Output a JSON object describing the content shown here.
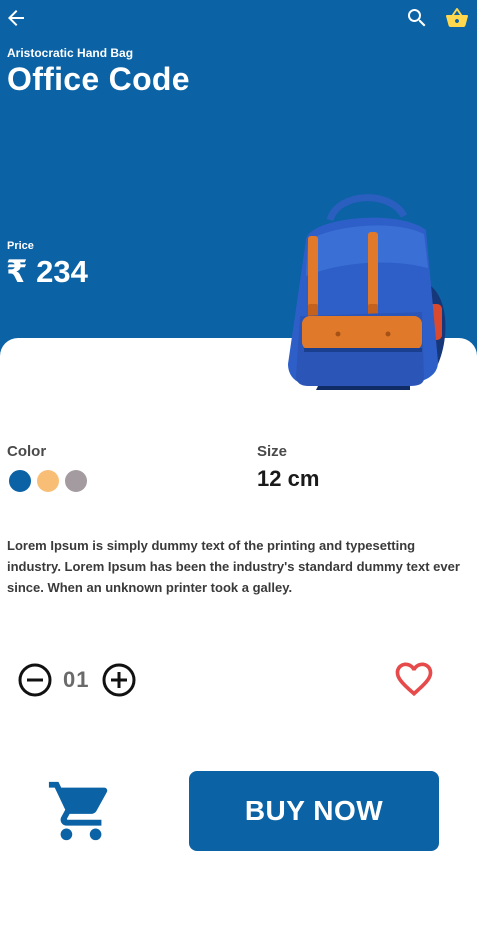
{
  "header": {
    "back_icon": "arrow-back-icon",
    "search_icon": "search-icon",
    "cart_icon": "shopping-basket-icon"
  },
  "product": {
    "brand": "Aristocratic Hand Bag",
    "name": "Office Code",
    "price_label": "Price",
    "price": "₹ 234"
  },
  "options": {
    "color_label": "Color",
    "colors": [
      "#0b62a4",
      "#f9be76",
      "#a39b9f"
    ],
    "selected_color": "#0b62a4",
    "size_label": "Size",
    "size_value": "12 cm"
  },
  "description": "Lorem Ipsum is simply dummy text of the printing and typesetting industry. Lorem Ipsum has been the industry's standard dummy text ever since. When an unknown printer took a galley.",
  "quantity": {
    "value": "01",
    "minus_icon": "minus-circle-icon",
    "plus_icon": "plus-circle-icon"
  },
  "favorite": {
    "icon": "heart-outline-icon",
    "color": "#e64a4a"
  },
  "actions": {
    "cart_icon": "add-to-cart-icon",
    "buy_label": "BUY NOW"
  },
  "theme": {
    "primary": "#0b62a4"
  }
}
